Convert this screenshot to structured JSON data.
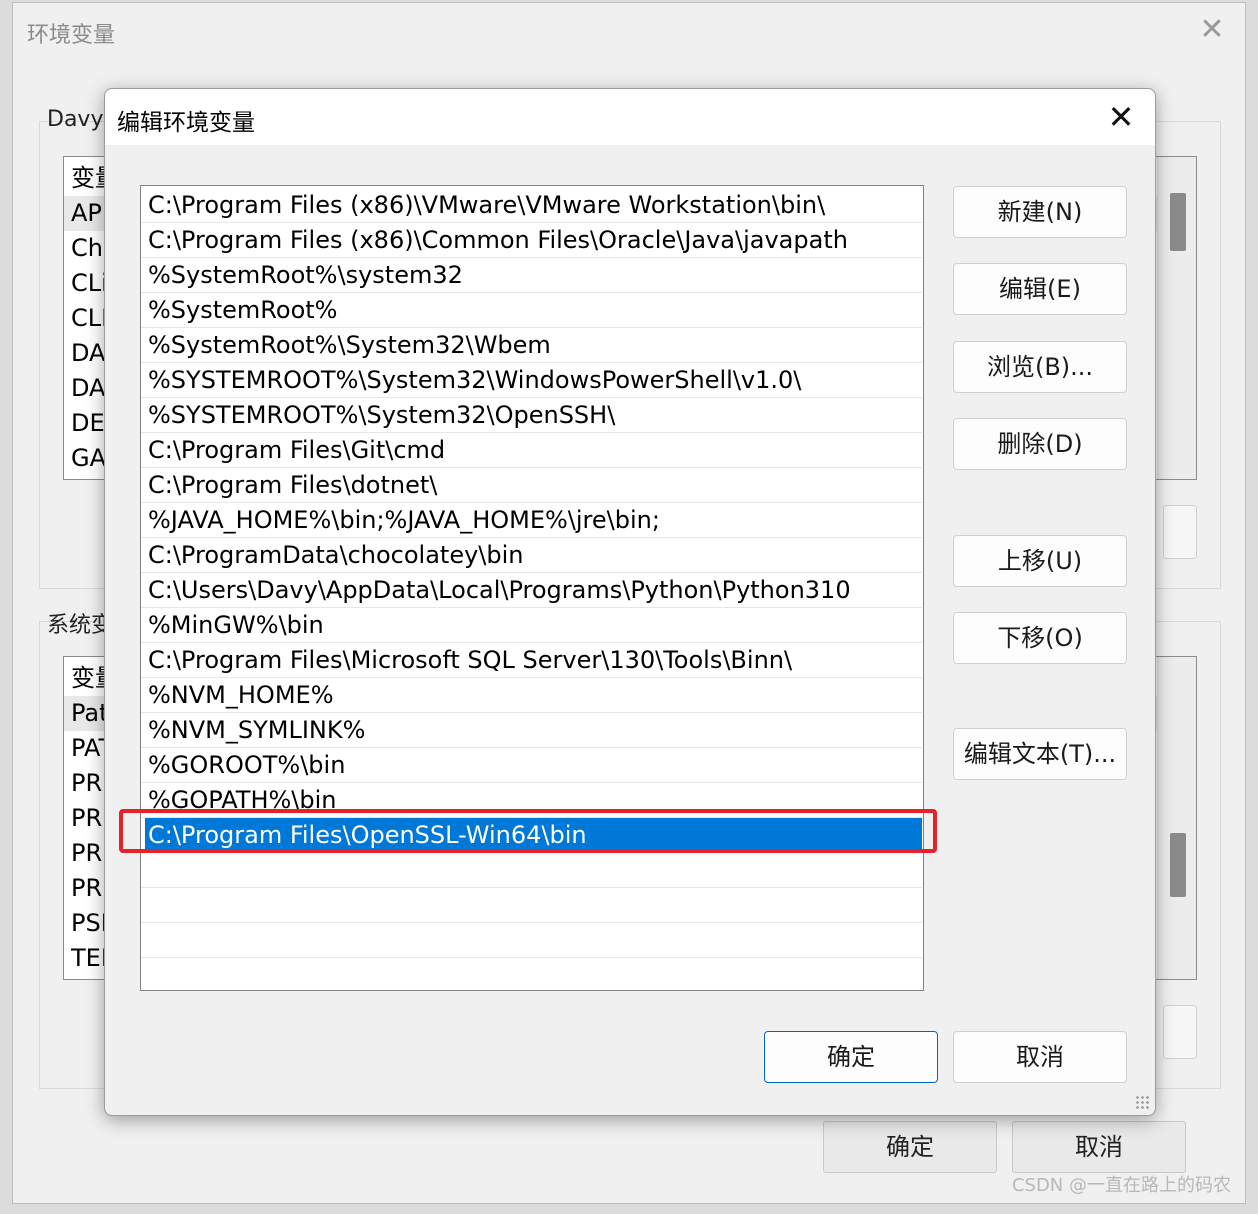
{
  "parent": {
    "title": "环境变量",
    "close_glyph": "✕",
    "user_group_label": "Davy",
    "user_vars": {
      "header": "变量",
      "rows": [
        "AP",
        "Ch",
        "CLi",
        "CLI",
        "DA",
        "DA",
        "DE",
        "GA"
      ]
    },
    "system_group_label": "系统变",
    "system_vars": {
      "header": "变量",
      "rows": [
        "Pat",
        "PAT",
        "PR",
        "PR",
        "PR",
        "PR",
        "PSI",
        "TEI"
      ]
    },
    "ok_label": "确定",
    "cancel_label": "取消"
  },
  "dialog": {
    "title": "编辑环境变量",
    "close_glyph": "✕",
    "paths": [
      "C:\\Program Files (x86)\\VMware\\VMware Workstation\\bin\\",
      "C:\\Program Files (x86)\\Common Files\\Oracle\\Java\\javapath",
      "%SystemRoot%\\system32",
      "%SystemRoot%",
      "%SystemRoot%\\System32\\Wbem",
      "%SYSTEMROOT%\\System32\\WindowsPowerShell\\v1.0\\",
      "%SYSTEMROOT%\\System32\\OpenSSH\\",
      "C:\\Program Files\\Git\\cmd",
      "C:\\Program Files\\dotnet\\",
      "%JAVA_HOME%\\bin;%JAVA_HOME%\\jre\\bin;",
      "C:\\ProgramData\\chocolatey\\bin",
      "C:\\Users\\Davy\\AppData\\Local\\Programs\\Python\\Python310",
      "%MinGW%\\bin",
      "C:\\Program Files\\Microsoft SQL Server\\130\\Tools\\Binn\\",
      "%NVM_HOME%",
      "%NVM_SYMLINK%",
      "%GOROOT%\\bin",
      "%GOPATH%\\bin",
      "C:\\Program Files\\OpenSSL-Win64\\bin"
    ],
    "selected_path": "C:\\Program Files\\OpenSSL-Win64\\bin",
    "buttons": {
      "new": "新建(N)",
      "edit": "编辑(E)",
      "browse": "浏览(B)...",
      "delete": "删除(D)",
      "move_up": "上移(U)",
      "move_down": "下移(O)",
      "edit_text": "编辑文本(T)...",
      "ok": "确定",
      "cancel": "取消"
    }
  },
  "watermark": "CSDN @一直在路上的码农",
  "colors": {
    "selection": "#0078d7",
    "highlight_box": "#e8202a",
    "dialog_bg": "#f0f0f0"
  }
}
